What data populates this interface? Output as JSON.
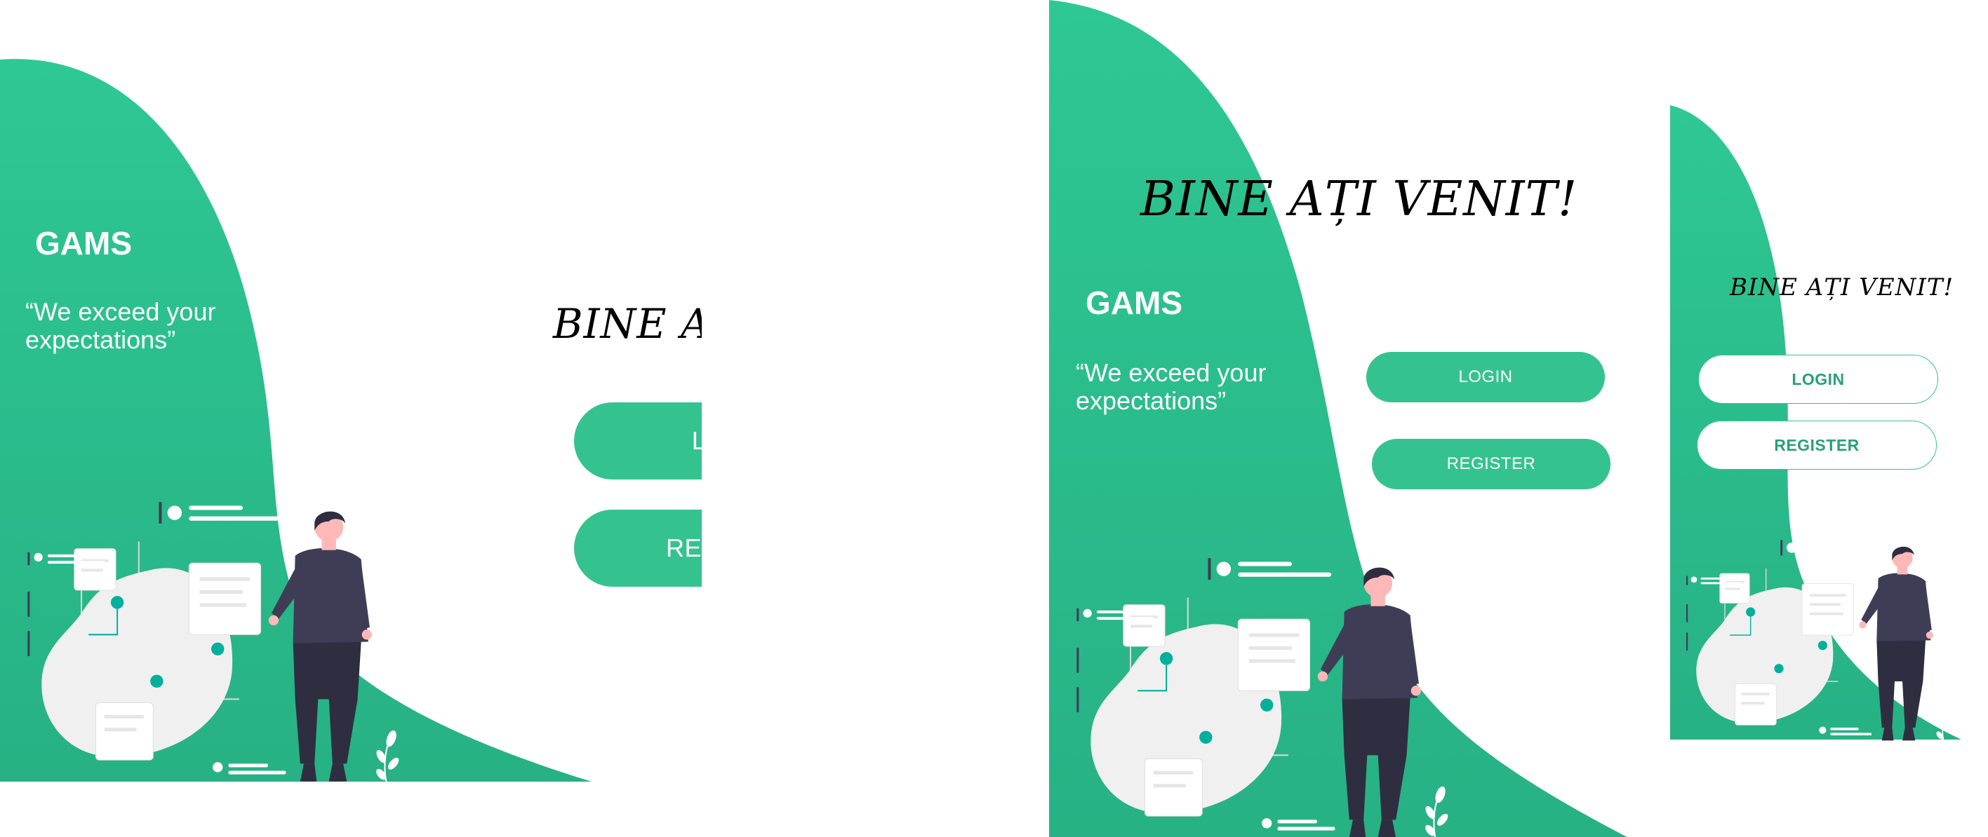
{
  "colors": {
    "accent": "#2ec894",
    "accent_dark": "#25a97d",
    "button": "#34c38f",
    "figure_top": "#3f3d56",
    "figure_pants": "#2f2e41",
    "skin": "#ffb8b8",
    "hair": "#2f2e41",
    "teal_dot": "#00b09b",
    "blob": "#f0f0f0"
  },
  "icons": [
    "person-illustration",
    "dashboard-illustration",
    "plant-icon",
    "dot-icon"
  ],
  "frames": [
    {
      "name": "desktop",
      "brand": "GAMS",
      "tagline": "“We exceed your expectations”",
      "welcome": "BINE AȚI VENIT!",
      "login_label": "LOGIN",
      "register_label": "REGISTER"
    },
    {
      "name": "tablet",
      "brand": "GAMS",
      "tagline": "“We exceed your expectations”",
      "welcome": "BINE AȚI VENIT!",
      "login_label": "LOGIN",
      "register_label": "REGISTER"
    },
    {
      "name": "mobile",
      "welcome": "BINE AȚI VENIT!",
      "login_label": "LOGIN",
      "register_label": "REGISTER"
    }
  ]
}
